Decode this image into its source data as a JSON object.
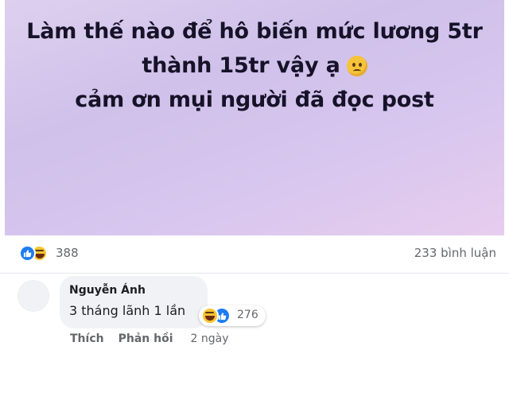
{
  "post": {
    "lines": [
      "Làm thế nào để hô biến mức lương 5tr",
      "thành 15tr vậy ạ",
      "cảm ơn mụi người đã đọc post"
    ],
    "line2_emoji": "sad-face-icon",
    "background_colors": [
      "#ddd0ee",
      "#cfc1ea",
      "#e7cdee"
    ]
  },
  "stats": {
    "reaction_icons": [
      "like-icon",
      "haha-icon"
    ],
    "reaction_count": "388",
    "comment_count": "233 bình luận"
  },
  "comment": {
    "author": "Nguyễn Ánh",
    "text": "3 tháng lãnh 1 lần",
    "reaction_icons": [
      "haha-icon",
      "like-icon"
    ],
    "reaction_count": "276",
    "actions": {
      "like_label": "Thích",
      "reply_label": "Phản hồi"
    },
    "time": "2 ngày"
  },
  "colors": {
    "like_blue": "#1d7cf2",
    "secondary_text": "#65676b",
    "bubble_bg": "#f0f2f5"
  }
}
